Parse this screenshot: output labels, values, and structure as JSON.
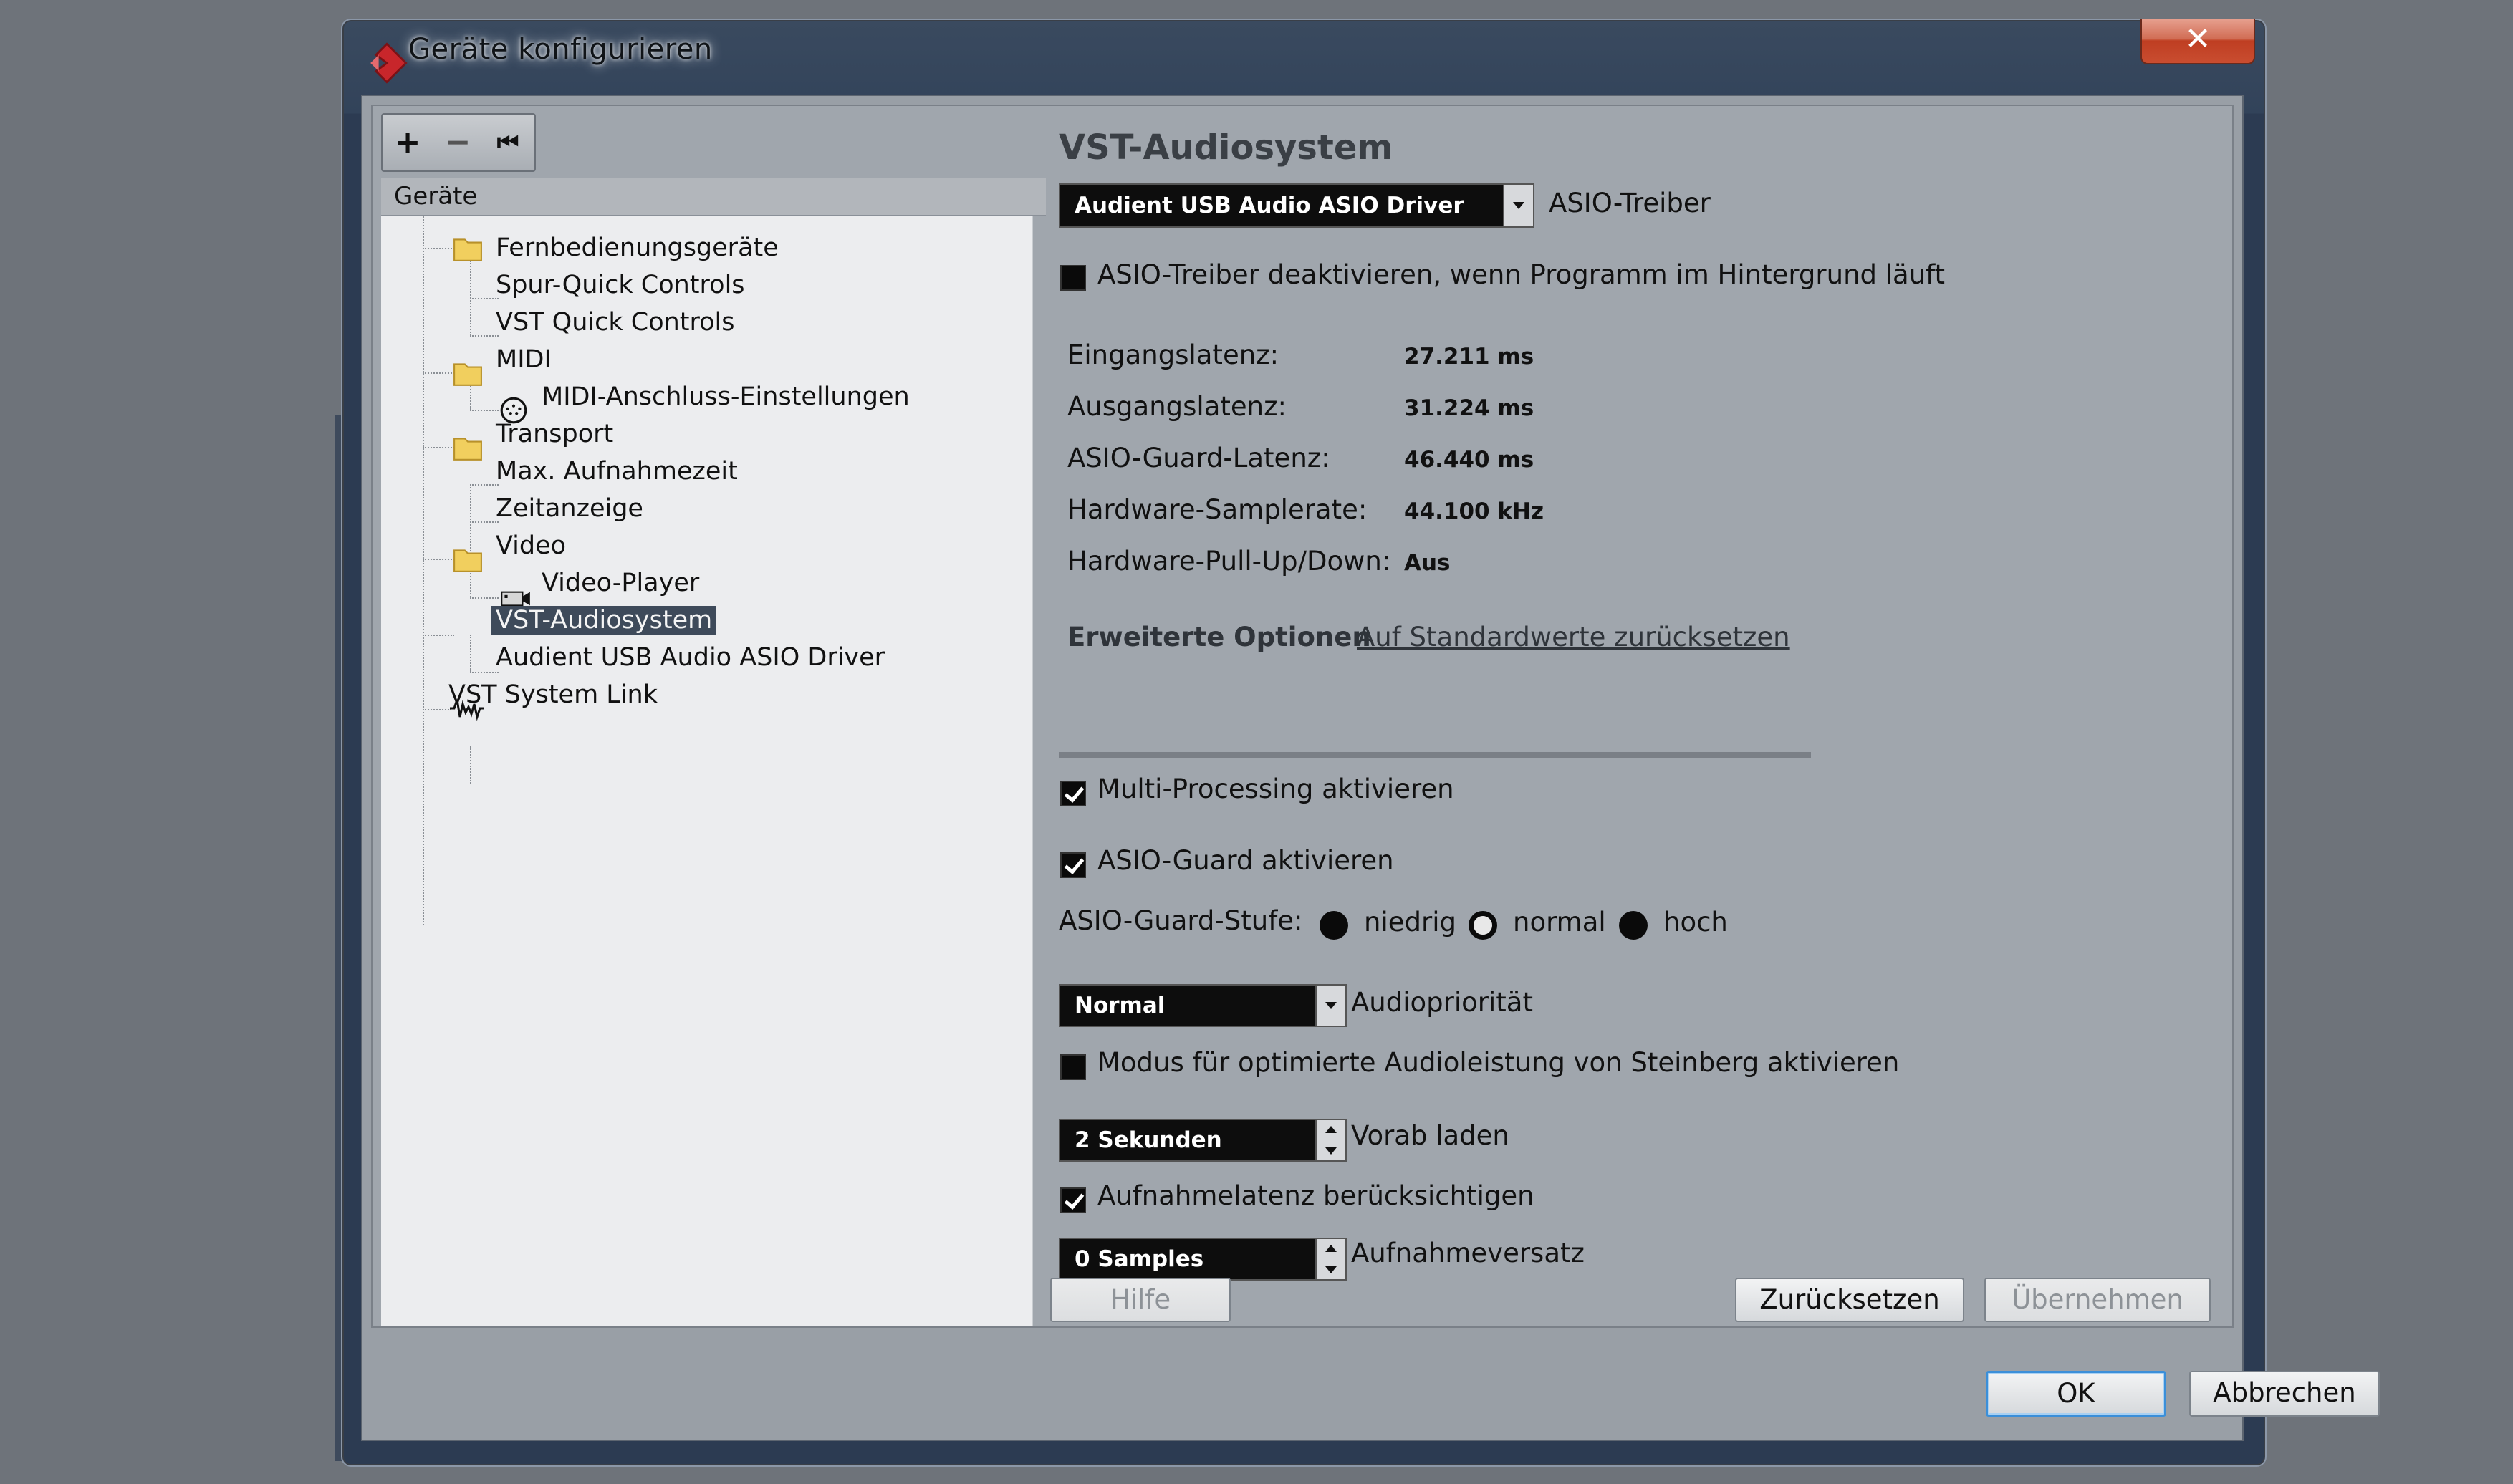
{
  "window": {
    "title": "Geräte konfigurieren",
    "close_glyph": "✕"
  },
  "tree_toolbar": {
    "add_glyph": "+",
    "remove_glyph": "−",
    "reset_glyph": "⏮"
  },
  "tree": {
    "header": "Geräte",
    "items": [
      {
        "label": "Fernbedienungsgeräte",
        "icon": "folder-icon"
      },
      {
        "label": "Spur-Quick Controls"
      },
      {
        "label": "VST Quick Controls"
      },
      {
        "label": "MIDI",
        "icon": "folder-icon"
      },
      {
        "label": "MIDI-Anschluss-Einstellungen",
        "icon": "midi-port-icon"
      },
      {
        "label": "Transport",
        "icon": "folder-icon"
      },
      {
        "label": "Max. Aufnahmezeit"
      },
      {
        "label": "Zeitanzeige"
      },
      {
        "label": "Video",
        "icon": "folder-icon"
      },
      {
        "label": "Video-Player",
        "icon": "video-player-icon"
      },
      {
        "label": "VST-Audiosystem",
        "icon": "audio-waveform-icon",
        "selected": true
      },
      {
        "label": "Audient USB Audio ASIO Driver"
      },
      {
        "label": "VST System Link"
      }
    ]
  },
  "panel": {
    "title": "VST-Audiosystem",
    "asio_driver": {
      "value": "Audient USB Audio ASIO Driver",
      "label": "ASIO-Treiber"
    },
    "deactivate_bg": {
      "label": "ASIO-Treiber deaktivieren, wenn Programm im Hintergrund läuft",
      "checked": false
    },
    "stats": [
      {
        "label": "Eingangslatenz:",
        "value": "27.211 ms"
      },
      {
        "label": "Ausgangslatenz:",
        "value": "31.224 ms"
      },
      {
        "label": "ASIO-Guard-Latenz:",
        "value": "46.440 ms"
      },
      {
        "label": "Hardware-Samplerate:",
        "value": "44.100 kHz"
      },
      {
        "label": "Hardware-Pull-Up/Down:",
        "value": "Aus"
      }
    ],
    "tabs": {
      "advanced": "Erweiterte Optionen",
      "reset_defaults": "Auf Standardwerte zurücksetzen"
    },
    "multiprocessing": {
      "label": "Multi-Processing aktivieren",
      "checked": true
    },
    "asio_guard": {
      "label": "ASIO-Guard aktivieren",
      "checked": true
    },
    "asio_guard_level": {
      "label": "ASIO-Guard-Stufe:",
      "options": [
        "niedrig",
        "normal",
        "hoch"
      ],
      "selected": "normal"
    },
    "audio_priority": {
      "value": "Normal",
      "label": "Audiopriorität"
    },
    "steinberg_mode": {
      "label": "Modus für optimierte Audioleistung von Steinberg aktivieren",
      "checked": false
    },
    "preload": {
      "value": "2 Sekunden",
      "label": "Vorab laden"
    },
    "record_latency": {
      "label": "Aufnahmelatenz berücksichtigen",
      "checked": true
    },
    "record_offset": {
      "value": "0 Samples",
      "label": "Aufnahmeversatz"
    },
    "buttons": {
      "help": "Hilfe",
      "reset": "Zurücksetzen",
      "apply": "Übernehmen"
    }
  },
  "dialog_buttons": {
    "ok": "OK",
    "cancel": "Abbrechen"
  },
  "colors": {
    "selection": "#3e4a5a",
    "primary_border": "#3b8fd9",
    "close": "#c94d30"
  }
}
